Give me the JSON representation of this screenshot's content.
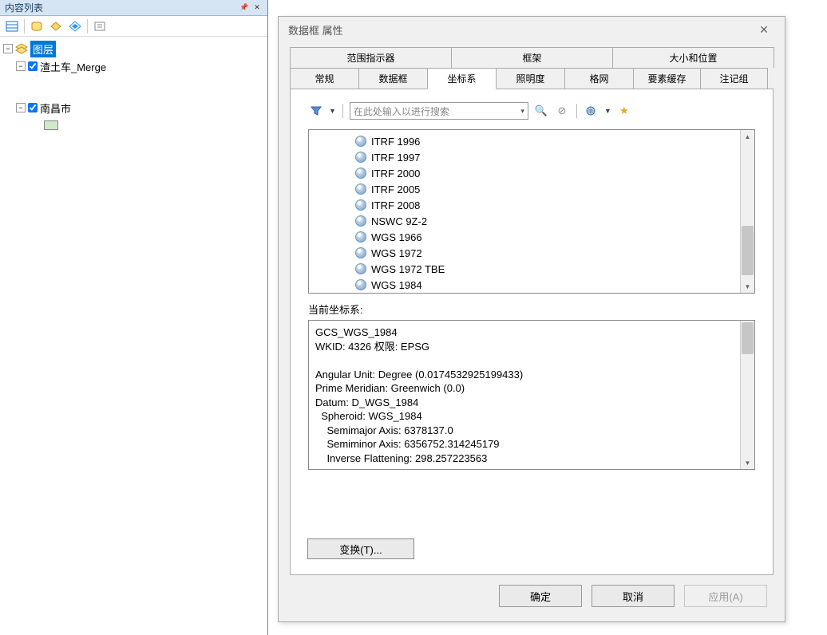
{
  "toc": {
    "title": "内容列表",
    "root_label": "图层",
    "layers": [
      {
        "name": "渣土车_Merge",
        "checked": true
      },
      {
        "name": "南昌市",
        "checked": true,
        "swatch": "#cfe9c7"
      }
    ]
  },
  "dialog": {
    "title": "数据框 属性",
    "tabs_top": [
      "范围指示器",
      "框架",
      "大小和位置"
    ],
    "tabs_bottom": [
      "常规",
      "数据框",
      "坐标系",
      "照明度",
      "格网",
      "要素缓存",
      "注记组"
    ],
    "active_tab": "坐标系",
    "search_placeholder": "在此处输入以进行搜索",
    "cs_list": [
      "ITRF 1996",
      "ITRF 1997",
      "ITRF 2000",
      "ITRF 2005",
      "ITRF 2008",
      "NSWC 9Z-2",
      "WGS 1966",
      "WGS 1972",
      "WGS 1972 TBE",
      "WGS 1984"
    ],
    "current_cs_label": "当前坐标系:",
    "current_cs_detail": "GCS_WGS_1984\nWKID: 4326 权限: EPSG\n\nAngular Unit: Degree (0.0174532925199433)\nPrime Meridian: Greenwich (0.0)\nDatum: D_WGS_1984\n  Spheroid: WGS_1984\n    Semimajor Axis: 6378137.0\n    Semiminor Axis: 6356752.314245179\n    Inverse Flattening: 298.257223563",
    "transform_btn": "变换(T)...",
    "footer": {
      "ok": "确定",
      "cancel": "取消",
      "apply": "应用(A)"
    }
  },
  "colors": {
    "map_fill": "#cfe9c7",
    "map_outline": "#5b0e8b"
  }
}
